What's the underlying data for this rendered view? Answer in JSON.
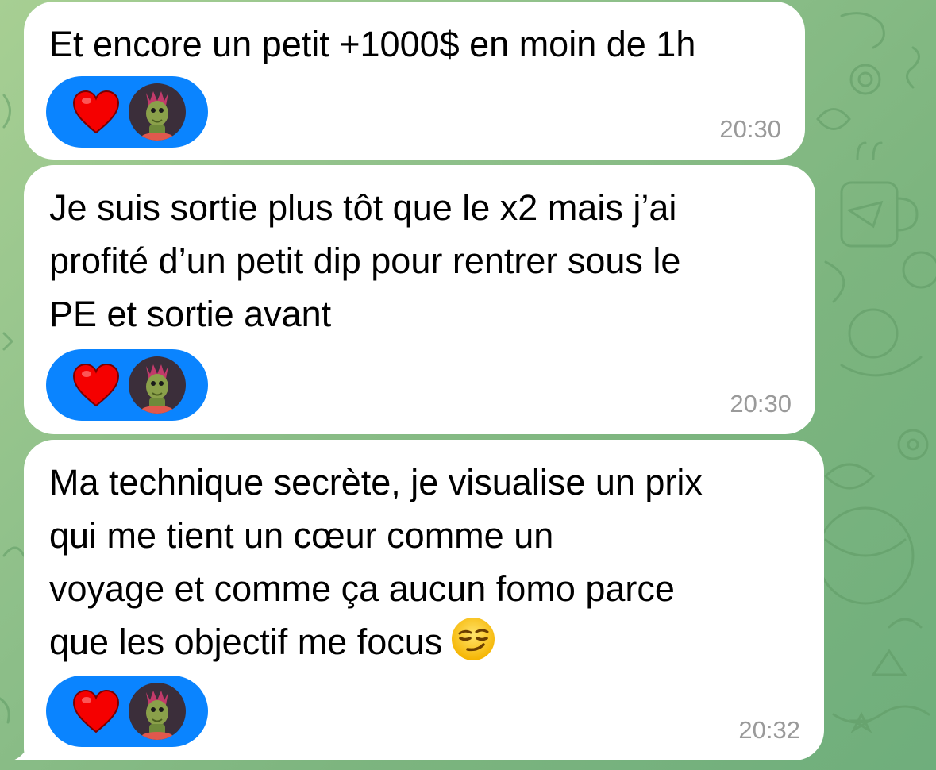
{
  "messages": [
    {
      "text": "Et encore un petit +1000$ en moin de 1h",
      "reaction": {
        "emoji": "heart-icon",
        "color": "#f50000",
        "bubble_color": "#0a84ff"
      },
      "time": "20:30"
    },
    {
      "text": "Je suis sortie plus tôt que le x2 mais j’ai\nprofité d’un petit dip pour rentrer sous le\nPE et sortie avant",
      "reaction": {
        "emoji": "heart-icon",
        "color": "#f50000",
        "bubble_color": "#0a84ff"
      },
      "time": "20:30"
    },
    {
      "text": "Ma technique secrète, je visualise un prix\nqui me tient un cœur comme un\nvoyage et comme ça aucun fomo parce\nque les objectif me focus",
      "emoji": "smirking-face-icon",
      "reaction": {
        "emoji": "heart-icon",
        "color": "#f50000",
        "bubble_color": "#0a84ff"
      },
      "time": "20:32"
    }
  ],
  "colors": {
    "bubble": "#ffffff",
    "timestamp": "#9a9a9a",
    "wallpaper": "#86bb84"
  }
}
